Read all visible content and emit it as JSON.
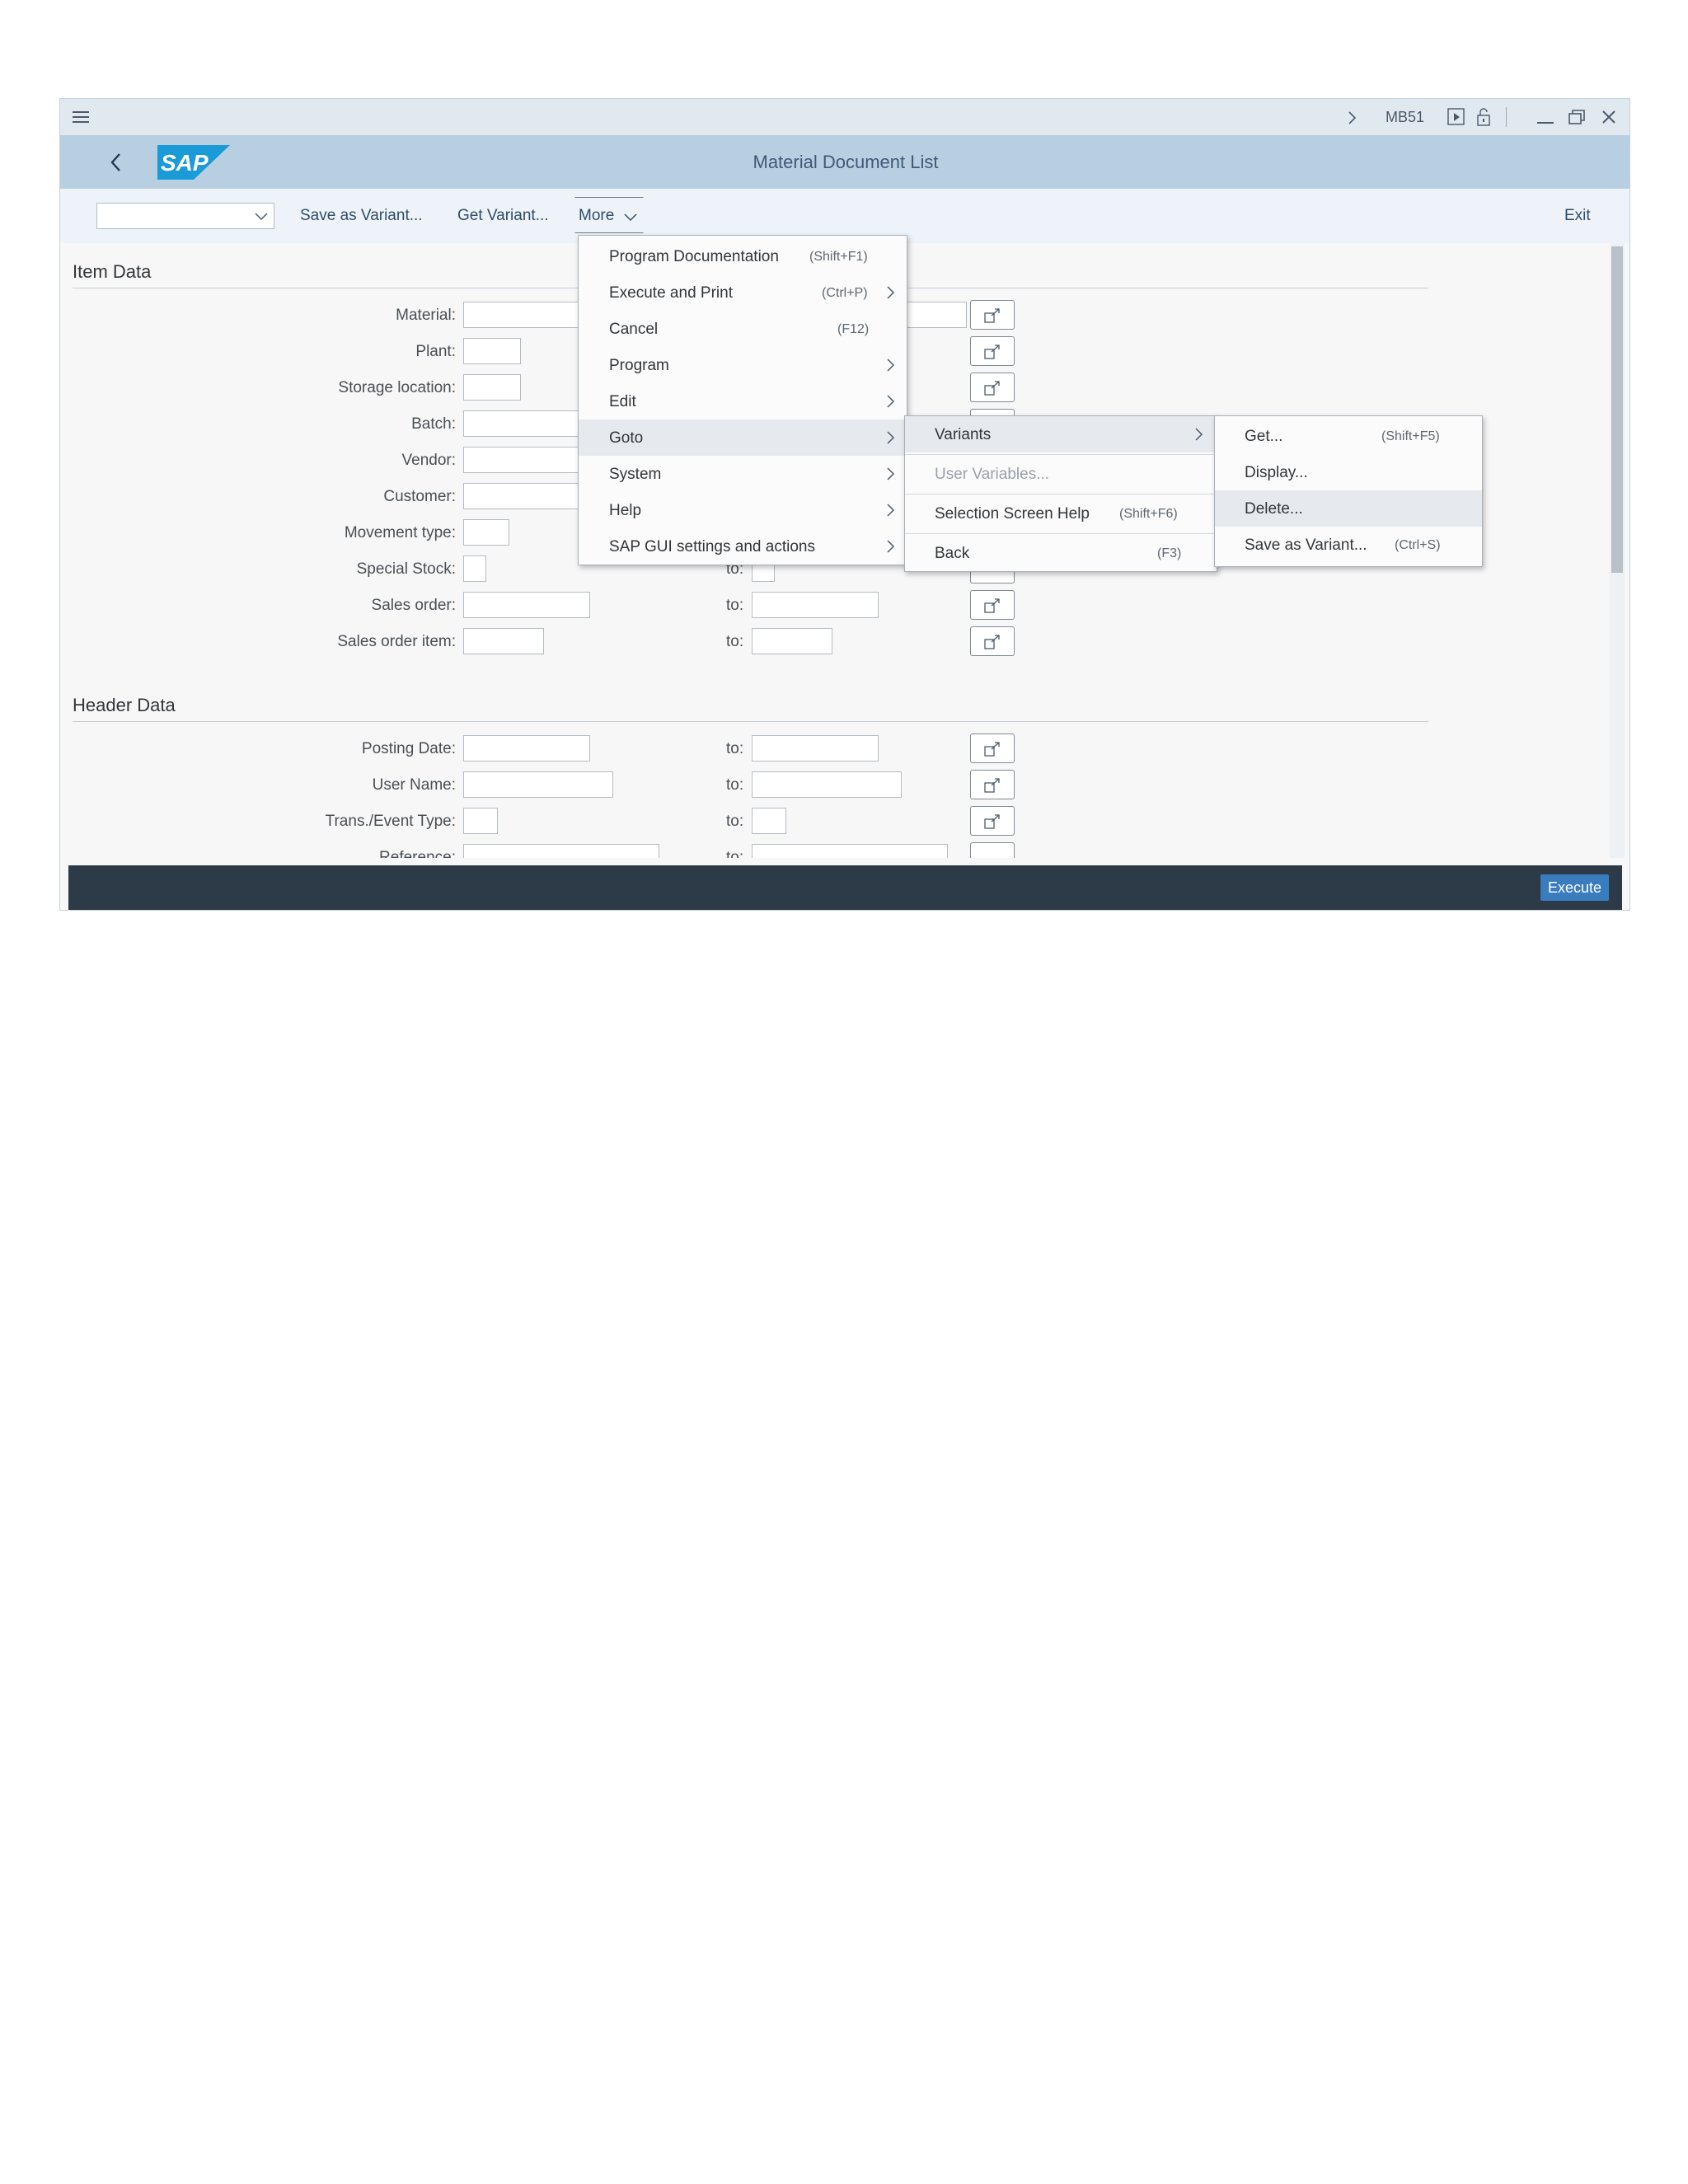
{
  "sysbar": {
    "tcode": "MB51"
  },
  "titlebar": {
    "logo": "SAP",
    "title": "Material Document List"
  },
  "toolbar": {
    "variant_select_value": "",
    "save_as_variant": "Save as Variant...",
    "get_variant": "Get Variant...",
    "more": "More",
    "exit": "Exit"
  },
  "item_data": {
    "title": "Item Data",
    "rows": [
      {
        "label": "Material:"
      },
      {
        "label": "Plant:"
      },
      {
        "label": "Storage location:"
      },
      {
        "label": "Batch:"
      },
      {
        "label": "Vendor:"
      },
      {
        "label": "Customer:"
      },
      {
        "label": "Movement type:"
      },
      {
        "label": "Special Stock:",
        "to": "to:"
      },
      {
        "label": "Sales order:",
        "to": "to:"
      },
      {
        "label": "Sales order item:",
        "to": "to:"
      }
    ]
  },
  "header_data": {
    "title": "Header Data",
    "rows": [
      {
        "label": "Posting Date:",
        "to": "to:"
      },
      {
        "label": "User Name:",
        "to": "to:"
      },
      {
        "label": "Trans./Event Type:",
        "to": "to:"
      },
      {
        "label": "Reference:",
        "to": "to:"
      }
    ]
  },
  "more_menu": {
    "items": [
      {
        "label": "Program Documentation",
        "shortcut": "(Shift+F1)"
      },
      {
        "label": "Execute and Print",
        "shortcut": "(Ctrl+P)"
      },
      {
        "label": "Cancel",
        "shortcut": "(F12)"
      },
      {
        "label": "Program"
      },
      {
        "label": "Edit"
      },
      {
        "label": "Goto"
      },
      {
        "label": "System"
      },
      {
        "label": "Help"
      },
      {
        "label": "SAP GUI settings and actions"
      }
    ]
  },
  "goto_menu": {
    "items": [
      {
        "label": "Variants"
      },
      {
        "label": "User Variables..."
      },
      {
        "label": "Selection Screen Help",
        "shortcut": "(Shift+F6)"
      },
      {
        "label": "Back",
        "shortcut": "(F3)"
      }
    ]
  },
  "variants_menu": {
    "items": [
      {
        "label": "Get...",
        "shortcut": "(Shift+F5)"
      },
      {
        "label": "Display..."
      },
      {
        "label": "Delete..."
      },
      {
        "label": "Save as Variant...",
        "shortcut": "(Ctrl+S)"
      }
    ]
  },
  "footer": {
    "execute": "Execute"
  },
  "colors": {
    "titlebar_bg": "#b8cfe2",
    "toolbar_bg": "#edf3f8",
    "footer_bg": "#2d3a48",
    "execute_bg": "#3a7dbf",
    "sap_logo": "#1a9ad6"
  }
}
